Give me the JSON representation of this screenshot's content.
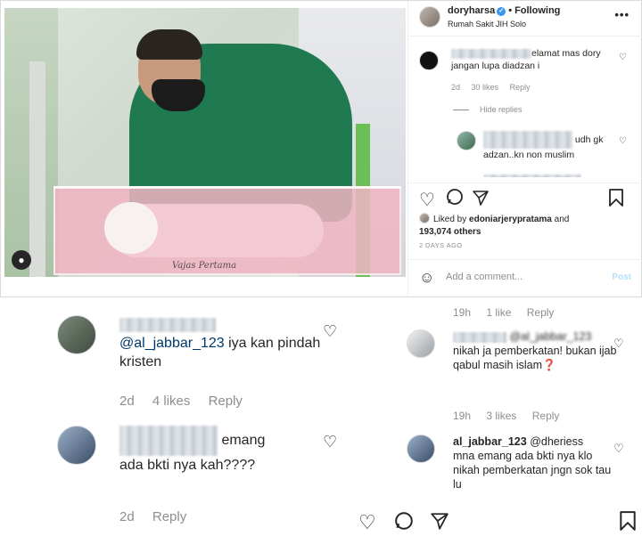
{
  "post": {
    "username": "doryharsa",
    "follow_state": "Following",
    "location": "Rumah Sakit JIH Solo",
    "more_icon": "more-options-icon",
    "photo_watermark": "Vajas Pertama",
    "comments": [
      {
        "text": "elamat mas dory jangan lupa diadzan i",
        "time": "2d",
        "likes": "30 likes",
        "reply": "Reply"
      },
      {
        "text": "udh gk adzan..kn non muslim"
      }
    ],
    "hide_replies": "Hide replies",
    "liked_by_prefix": "Liked by",
    "liked_by_user": "edoniarjerypratama",
    "liked_by_and": "and",
    "liked_by_count": "193,074 others",
    "posted_ago": "2 DAYS AGO",
    "add_comment_placeholder": "Add a comment...",
    "post_button": "Post",
    "icons": [
      "heart-icon",
      "comment-icon",
      "share-icon",
      "bookmark-icon",
      "emoji-icon"
    ]
  },
  "left_zoom": {
    "comments": [
      {
        "mention": "@al_jabbar_123",
        "text": " iya kan pindah kristen",
        "time": "2d",
        "likes": "4 likes",
        "reply": "Reply"
      },
      {
        "text": "emang ada bkti nya kah????",
        "time": "2d",
        "reply": "Reply"
      }
    ]
  },
  "right_zoom": {
    "top_meta": {
      "time": "19h",
      "likes": "1 like",
      "reply": "Reply"
    },
    "comments": [
      {
        "mention": "@al_jabbar_123",
        "text": "nikah ja pemberkatan! bukan ijab qabul masih islam",
        "emoji": "❓",
        "time": "19h",
        "likes": "3 likes",
        "reply": "Reply"
      },
      {
        "username": "al_jabbar_123",
        "mention": "@dheriess",
        "text": "mna emang ada bkti nya klo nikah pemberkatan jngn sok tau lu"
      }
    ]
  },
  "colors": {
    "link": "#00376b",
    "verified": "#3897f0",
    "muted": "#8e8e8e",
    "post_disabled": "#b2dffc"
  }
}
